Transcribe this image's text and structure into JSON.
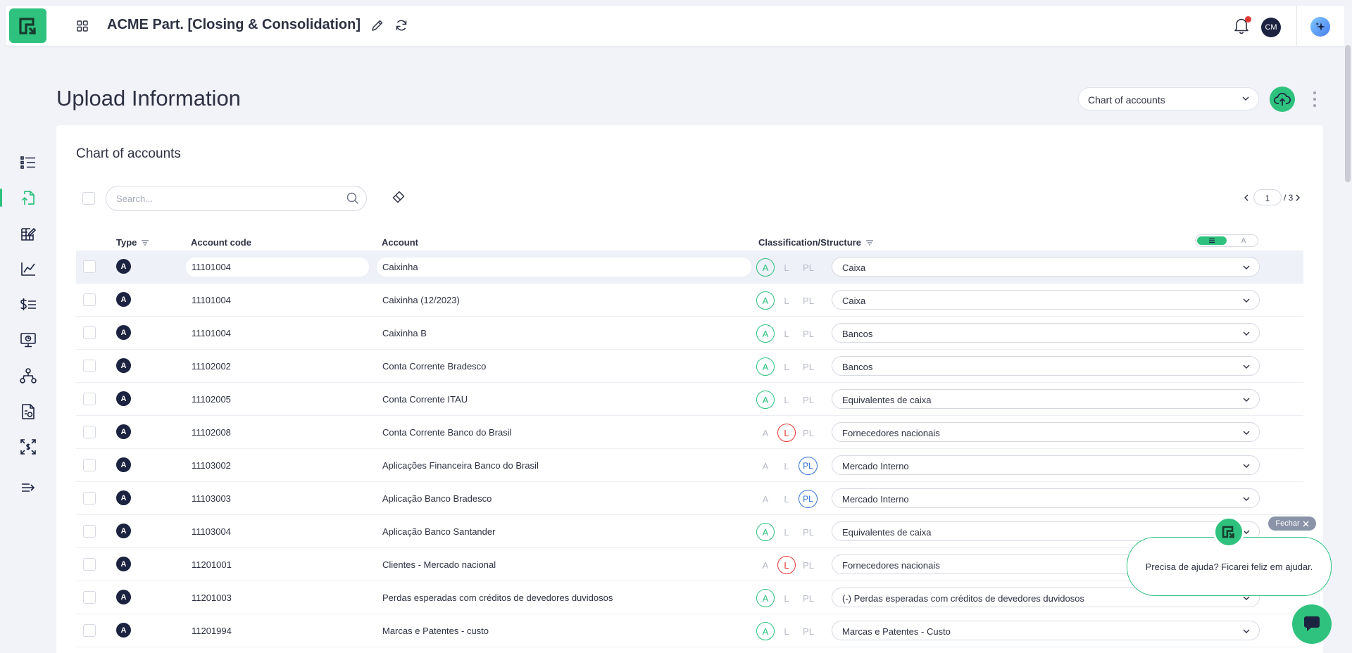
{
  "header": {
    "app_title": "ACME Part. [Closing & Consolidation]",
    "avatar_initials": "CM",
    "has_notification": true
  },
  "sidebar": {
    "items": [
      {
        "name": "list-icon",
        "active": false
      },
      {
        "name": "upload-file-icon",
        "active": true
      },
      {
        "name": "edit-table-icon",
        "active": false
      },
      {
        "name": "chart-line-icon",
        "active": false
      },
      {
        "name": "dollar-list-icon",
        "active": false
      },
      {
        "name": "monitor-icon",
        "active": false
      },
      {
        "name": "hierarchy-icon",
        "active": false
      },
      {
        "name": "report-file-icon",
        "active": false
      },
      {
        "name": "expand-dollar-icon",
        "active": false
      },
      {
        "name": "collapse-arrow-icon",
        "active": false
      }
    ]
  },
  "page": {
    "title": "Upload Information",
    "select_value": "Chart of accounts"
  },
  "card": {
    "title": "Chart of accounts",
    "search_placeholder": "Search...",
    "pager": {
      "current": "1",
      "total_label": "/ 3"
    }
  },
  "table": {
    "headers": {
      "type": "Type",
      "code": "Account code",
      "account": "Account",
      "classification": "Classification/Structure"
    },
    "toggle_off_label": "A",
    "class_labels": {
      "a": "A",
      "l": "L",
      "pl": "PL"
    },
    "rows": [
      {
        "type": "A",
        "code": "11101004",
        "account": "Caixinha",
        "cls": "A",
        "structure": "Caixa",
        "selected": true
      },
      {
        "type": "A",
        "code": "11101004",
        "account": "Caixinha (12/2023)",
        "cls": "A",
        "structure": "Caixa"
      },
      {
        "type": "A",
        "code": "11101004",
        "account": "Caixinha B",
        "cls": "A",
        "structure": "Bancos"
      },
      {
        "type": "A",
        "code": "11102002",
        "account": "Conta Corrente Bradesco",
        "cls": "A",
        "structure": "Bancos"
      },
      {
        "type": "A",
        "code": "11102005",
        "account": "Conta Corrente ITAU",
        "cls": "A",
        "structure": "Equivalentes de caixa"
      },
      {
        "type": "A",
        "code": "11102008",
        "account": "Conta Corrente Banco do Brasil",
        "cls": "L",
        "structure": "Fornecedores nacionais"
      },
      {
        "type": "A",
        "code": "11103002",
        "account": "Aplicações Financeira Banco do Brasil",
        "cls": "PL",
        "structure": "Mercado Interno"
      },
      {
        "type": "A",
        "code": "11103003",
        "account": "Aplicação Banco Bradesco",
        "cls": "PL",
        "structure": "Mercado Interno"
      },
      {
        "type": "A",
        "code": "11103004",
        "account": "Aplicação Banco Santander",
        "cls": "A",
        "structure": "Equivalentes de caixa"
      },
      {
        "type": "A",
        "code": "11201001",
        "account": "Clientes - Mercado nacional",
        "cls": "L",
        "structure": "Fornecedores nacionais"
      },
      {
        "type": "A",
        "code": "11201003",
        "account": "Perdas esperadas com créditos de devedores duvidosos",
        "cls": "A",
        "structure": "(-) Perdas esperadas com créditos de devedores duvidosos"
      },
      {
        "type": "A",
        "code": "11201994",
        "account": "Marcas e Patentes - custo",
        "cls": "A",
        "structure": "Marcas e Patentes - Custo"
      }
    ]
  },
  "help": {
    "close_label": "Fechar",
    "message": "Precisa de ajuda? Ficarei feliz em ajudar."
  },
  "colors": {
    "brand": "#2ec27e",
    "asset": "#2ec27e",
    "liability": "#e53935",
    "equity": "#2f6fd6",
    "type_badge": "#1c2340"
  }
}
